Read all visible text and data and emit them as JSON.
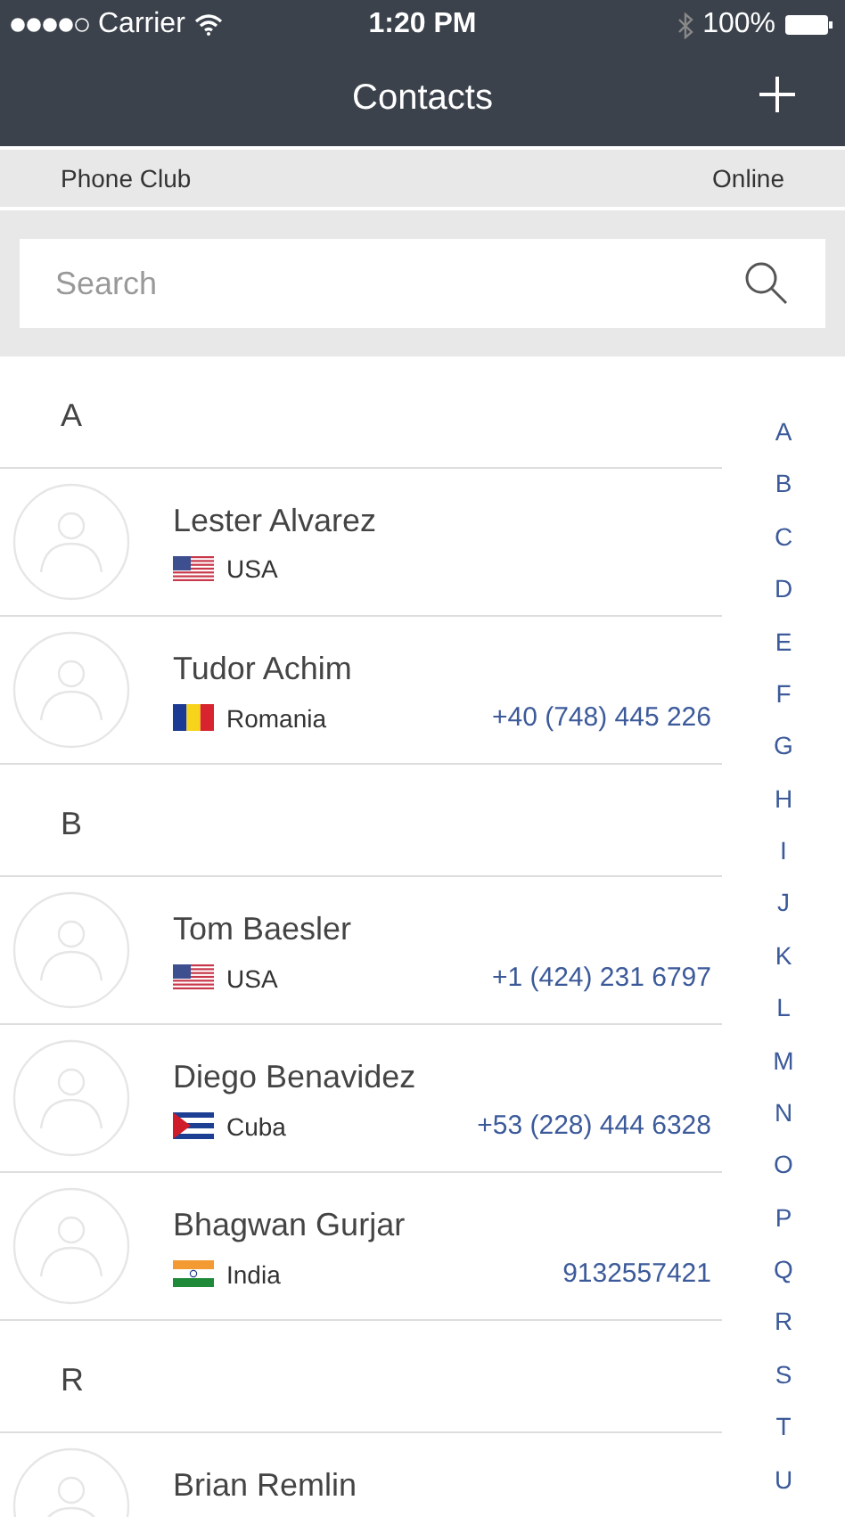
{
  "status_bar": {
    "carrier": "Carrier",
    "time": "1:20 PM",
    "battery": "100%"
  },
  "nav": {
    "title": "Contacts"
  },
  "account": {
    "name": "Phone Club",
    "status": "Online"
  },
  "search": {
    "placeholder": "Search"
  },
  "sections": [
    {
      "letter": "A",
      "contacts": [
        {
          "name": "Lester Alvarez",
          "kind": "usa",
          "country": "USA"
        },
        {
          "name": "Tudor Achim",
          "kind": "romania",
          "country": "Romania",
          "phone": "+40 (748) 445 226"
        }
      ]
    },
    {
      "letter": "B",
      "contacts": [
        {
          "name": "Tom Baesler",
          "kind": "usa",
          "country": "USA",
          "phone": "+1 (424) 231 6797"
        },
        {
          "name": "Diego Benavidez",
          "kind": "cuba",
          "country": "Cuba",
          "phone": "+53 (228) 444 6328"
        },
        {
          "name": "Bhagwan Gurjar",
          "kind": "india",
          "country": "India",
          "phone": "9132557421"
        }
      ]
    },
    {
      "letter": "R",
      "contacts": [
        {
          "name": "Brian Remlin"
        }
      ]
    }
  ],
  "index": [
    "A",
    "B",
    "C",
    "D",
    "E",
    "F",
    "G",
    "H",
    "I",
    "J",
    "K",
    "L",
    "M",
    "N",
    "O",
    "P",
    "Q",
    "R",
    "S",
    "T",
    "U"
  ]
}
